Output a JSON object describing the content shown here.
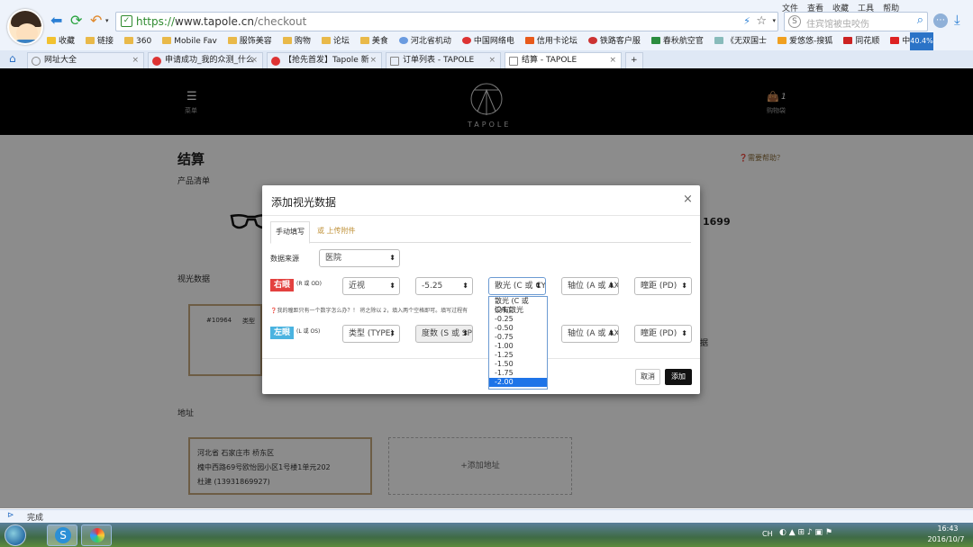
{
  "browser": {
    "url_scheme": "https://",
    "url_host": "www.tapole.cn",
    "url_path": "/checkout",
    "search_placeholder": "住宾馆被虫咬伤",
    "menu": [
      "文件",
      "查看",
      "收藏",
      "工具",
      "帮助"
    ],
    "bookmarks": [
      "收藏",
      "链接",
      "360",
      "Mobile Fav",
      "服饰美容",
      "购物",
      "论坛",
      "美食",
      "河北省机动",
      "中国网络电",
      "信用卡论坛",
      "铁路客户服",
      "春秋航空官",
      "《无双国士",
      "爱悠悠-搜狐",
      "同花顺",
      "中国工商"
    ],
    "zoom_badge": "40.4%",
    "tabs": [
      {
        "label": "网址大全",
        "active": false
      },
      {
        "label": "申请成功_我的众测_什么",
        "active": false
      },
      {
        "label": "【抢先首发】Tapole 新",
        "active": false
      },
      {
        "label": "订单列表 - TAPOLE",
        "active": false
      },
      {
        "label": "结算 - TAPOLE",
        "active": true
      }
    ]
  },
  "site": {
    "menu_label": "菜单",
    "brand": "TAPOLE",
    "cart_label": "购物袋",
    "cart_count": "1"
  },
  "page": {
    "title": "结算",
    "help_link": "需要帮助？",
    "product_section": "产品清单",
    "price_partial": "1699",
    "prescription_section": "视光数据",
    "prescription_card_id": "#10964",
    "prescription_card_type": "类型",
    "partial_text": "据",
    "address_section": "地址",
    "address": {
      "line1": "河北省 石家庄市 桥东区",
      "line2": "槐中西路69号欧怡园小区1号楼1单元202",
      "line3": "杜建 (13931869927)"
    },
    "add_address": "添加地址"
  },
  "modal": {
    "title": "添加视光数据",
    "tab_manual": "手动填写",
    "tab_upload": "或 上传附件",
    "source_label": "数据来源",
    "source_value": "医院",
    "right_eye_label": "右眼",
    "right_eye_sub": "(R 或 OD)",
    "right_type": "近视",
    "right_sph": "-5.25",
    "right_cyl": "散光 (C 或 CYL)",
    "right_axis": "轴位 (A 或 AXIS)",
    "right_pd": "瞳距 (PD)",
    "hint": "我的瞳距只有一个数字怎么办？！ 将之除以 2，填入两个空格即可。填写过程有",
    "hint_tail": "问。",
    "left_eye_label": "左眼",
    "left_eye_sub": "(L 或 OS)",
    "left_type": "类型 (TYPE)",
    "left_sph": "度数 (S 或 SPH)",
    "left_axis": "轴位 (A 或 AXIS)",
    "left_pd": "瞳距 (PD)",
    "cancel": "取消",
    "add": "添加",
    "cyl_options": [
      "散光 (C 或 CYL)",
      "没有散光",
      "-0.25",
      "-0.50",
      "-0.75",
      "-1.00",
      "-1.25",
      "-1.50",
      "-1.75",
      "-2.00"
    ],
    "cyl_highlight": "-2.00"
  },
  "status": {
    "text": "完成"
  },
  "taskbar": {
    "ime": "CH",
    "time": "16:43",
    "date": "2016/10/7"
  },
  "colors": {
    "right_eye_badge": "#e3413f",
    "left_eye_badge": "#4ab3e0",
    "highlight": "#1e74e8"
  }
}
